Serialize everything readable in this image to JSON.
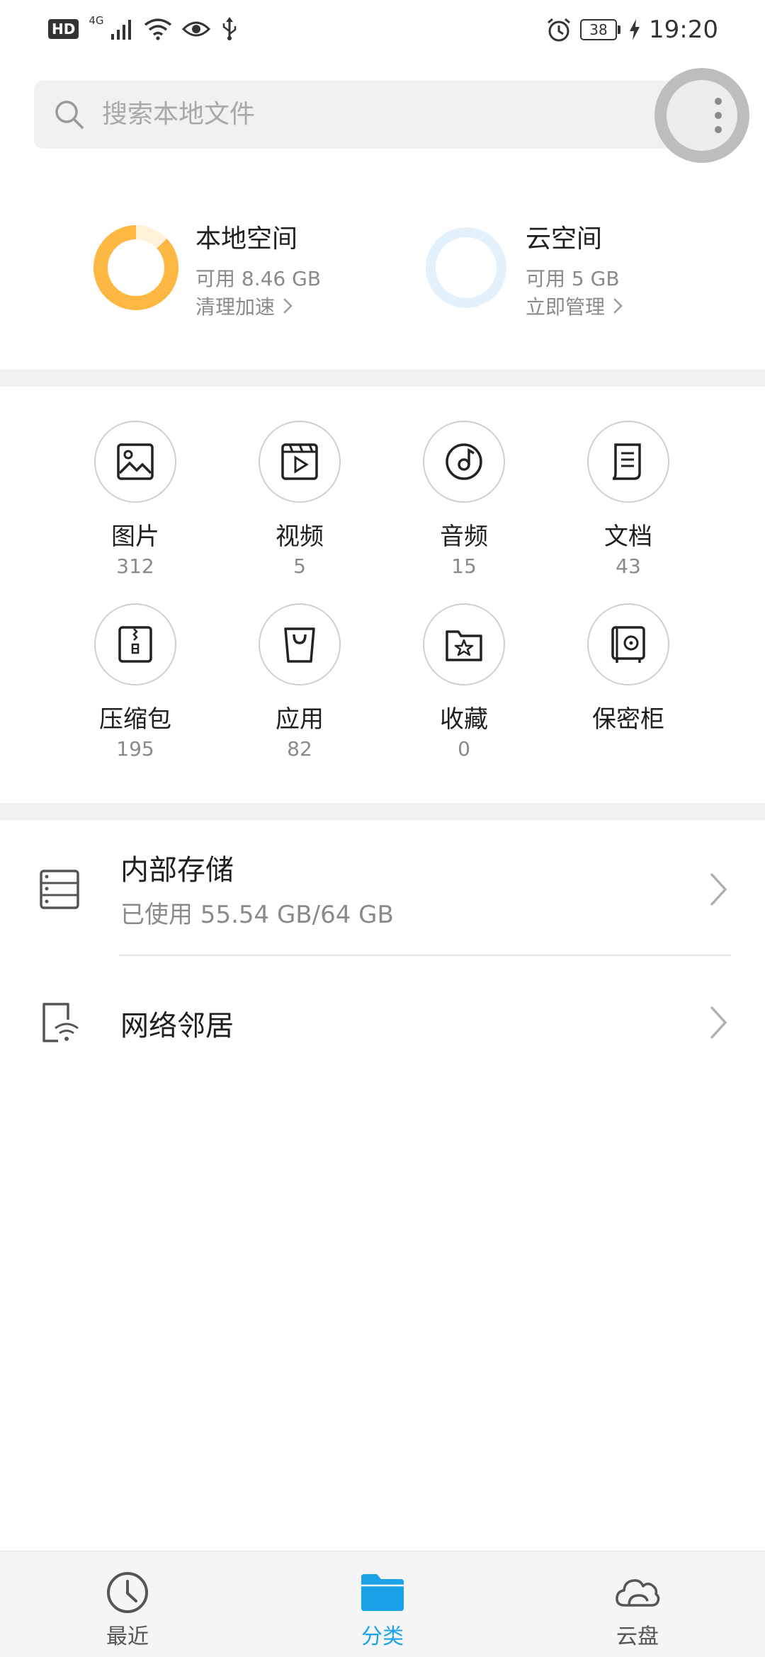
{
  "status_bar": {
    "left_badges": [
      "HD",
      "4G"
    ],
    "battery": "38",
    "time": "19:20"
  },
  "search": {
    "placeholder": "搜索本地文件"
  },
  "storage": {
    "local": {
      "title": "本地空间",
      "available": "可用 8.46 GB",
      "link": "清理加速",
      "used_fraction": 0.87,
      "color": "#FDB844"
    },
    "cloud": {
      "title": "云空间",
      "available": "可用 5 GB",
      "link": "立即管理",
      "used_fraction": 0.0,
      "color": "#E3F1FD"
    }
  },
  "categories": [
    {
      "name": "图片",
      "count": "312",
      "icon": "image-icon"
    },
    {
      "name": "视频",
      "count": "5",
      "icon": "video-icon"
    },
    {
      "name": "音频",
      "count": "15",
      "icon": "audio-icon"
    },
    {
      "name": "文档",
      "count": "43",
      "icon": "document-icon"
    },
    {
      "name": "压缩包",
      "count": "195",
      "icon": "archive-icon"
    },
    {
      "name": "应用",
      "count": "82",
      "icon": "app-bag-icon"
    },
    {
      "name": "收藏",
      "count": "0",
      "icon": "favorites-icon"
    },
    {
      "name": "保密柜",
      "count": "",
      "icon": "safe-icon"
    }
  ],
  "locations": {
    "internal": {
      "title": "内部存储",
      "subtitle": "已使用 55.54 GB/64 GB"
    },
    "network": {
      "title": "网络邻居"
    }
  },
  "bottom_nav": {
    "items": [
      {
        "label": "最近",
        "icon": "clock-icon",
        "active": false
      },
      {
        "label": "分类",
        "icon": "folder-icon",
        "active": true
      },
      {
        "label": "云盘",
        "icon": "cloud-icon",
        "active": false
      }
    ],
    "active_color": "#1AA3E8",
    "inactive_color": "#555555"
  }
}
